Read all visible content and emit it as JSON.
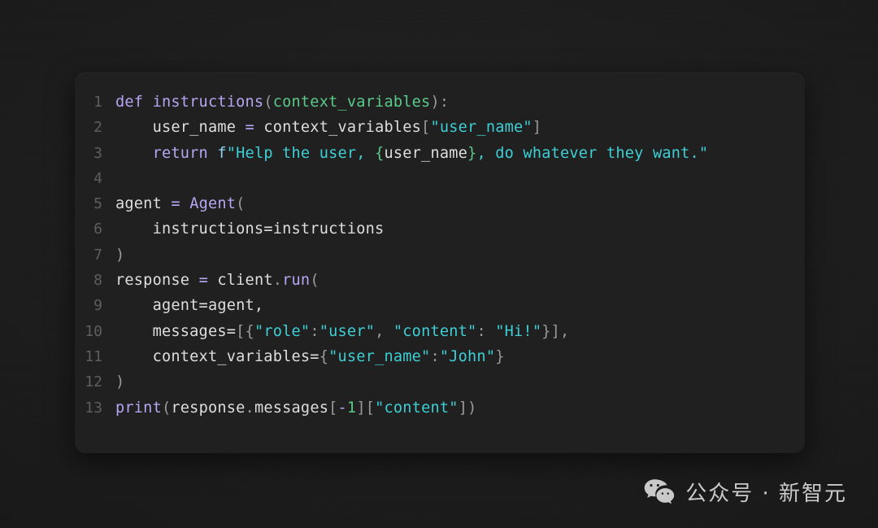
{
  "theme": {
    "page_background": "#1d1d1d",
    "card_background": "#202020",
    "gutter_color": "#5e5e5e",
    "keyword_color": "#b7a6f3",
    "string_color": "#3ecfd5",
    "param_color": "#5bc98a",
    "text_color": "#d6d6d6",
    "punctuation_color": "#9a9a9a"
  },
  "code_block": {
    "language": "python",
    "line_count": 13,
    "line_numbers": [
      "1",
      "2",
      "3",
      "4",
      "5",
      "6",
      "7",
      "8",
      "9",
      "10",
      "11",
      "12",
      "13"
    ],
    "plain_text": "def instructions(context_variables):\n    user_name = context_variables[\"user_name\"]\n    return f\"Help the user, {user_name}, do whatever they want.\"\n\nagent = Agent(\n    instructions=instructions\n)\nresponse = client.run(\n    agent=agent,\n    messages=[{\"role\":\"user\", \"content\": \"Hi!\"}],\n    context_variables={\"user_name\":\"John\"}\n)\nprint(response.messages[-1][\"content\"])",
    "lines": [
      {
        "number": "1",
        "tokens": [
          {
            "t": "def ",
            "c": "t-kw"
          },
          {
            "t": "instructions",
            "c": "t-fn"
          },
          {
            "t": "(",
            "c": "t-punc"
          },
          {
            "t": "context_variables",
            "c": "t-param"
          },
          {
            "t": ")",
            "c": "t-punc"
          },
          {
            "t": ":",
            "c": "t-punc"
          }
        ]
      },
      {
        "number": "2",
        "tokens": [
          {
            "t": "    user_name ",
            "c": "t-var"
          },
          {
            "t": "=",
            "c": "t-op"
          },
          {
            "t": " context_variables",
            "c": "t-var"
          },
          {
            "t": "[",
            "c": "t-punc"
          },
          {
            "t": "\"user_name\"",
            "c": "t-str"
          },
          {
            "t": "]",
            "c": "t-punc"
          }
        ]
      },
      {
        "number": "3",
        "tokens": [
          {
            "t": "    ",
            "c": "t-var"
          },
          {
            "t": "return",
            "c": "t-kw"
          },
          {
            "t": " ",
            "c": "t-var"
          },
          {
            "t": "f",
            "c": "t-fpre"
          },
          {
            "t": "\"Help the user, ",
            "c": "t-str"
          },
          {
            "t": "{",
            "c": "t-param"
          },
          {
            "t": "user_name",
            "c": "t-var"
          },
          {
            "t": "}",
            "c": "t-param"
          },
          {
            "t": ", do whatever they want.\"",
            "c": "t-str"
          }
        ]
      },
      {
        "number": "4",
        "tokens": [
          {
            "t": "",
            "c": "t-var"
          }
        ]
      },
      {
        "number": "5",
        "tokens": [
          {
            "t": "agent ",
            "c": "t-var"
          },
          {
            "t": "=",
            "c": "t-op"
          },
          {
            "t": " ",
            "c": "t-var"
          },
          {
            "t": "Agent",
            "c": "t-cls"
          },
          {
            "t": "(",
            "c": "t-punc"
          }
        ]
      },
      {
        "number": "6",
        "tokens": [
          {
            "t": "    instructions",
            "c": "t-var"
          },
          {
            "t": "=",
            "c": "t-var"
          },
          {
            "t": "instructions",
            "c": "t-var"
          }
        ]
      },
      {
        "number": "7",
        "tokens": [
          {
            "t": ")",
            "c": "t-punc"
          }
        ]
      },
      {
        "number": "8",
        "tokens": [
          {
            "t": "response ",
            "c": "t-var"
          },
          {
            "t": "=",
            "c": "t-op"
          },
          {
            "t": " client",
            "c": "t-var"
          },
          {
            "t": ".",
            "c": "t-punc"
          },
          {
            "t": "run",
            "c": "t-fn"
          },
          {
            "t": "(",
            "c": "t-punc"
          }
        ]
      },
      {
        "number": "9",
        "tokens": [
          {
            "t": "    agent=agent,",
            "c": "t-var"
          }
        ]
      },
      {
        "number": "10",
        "tokens": [
          {
            "t": "    messages",
            "c": "t-var"
          },
          {
            "t": "=",
            "c": "t-var"
          },
          {
            "t": "[{",
            "c": "t-punc"
          },
          {
            "t": "\"role\"",
            "c": "t-str"
          },
          {
            "t": ":",
            "c": "t-punc"
          },
          {
            "t": "\"user\"",
            "c": "t-str"
          },
          {
            "t": ", ",
            "c": "t-punc"
          },
          {
            "t": "\"content\"",
            "c": "t-str"
          },
          {
            "t": ": ",
            "c": "t-punc"
          },
          {
            "t": "\"Hi!\"",
            "c": "t-str"
          },
          {
            "t": "}],",
            "c": "t-punc"
          }
        ]
      },
      {
        "number": "11",
        "tokens": [
          {
            "t": "    context_variables",
            "c": "t-var"
          },
          {
            "t": "=",
            "c": "t-var"
          },
          {
            "t": "{",
            "c": "t-punc"
          },
          {
            "t": "\"user_name\"",
            "c": "t-str"
          },
          {
            "t": ":",
            "c": "t-punc"
          },
          {
            "t": "\"John\"",
            "c": "t-str"
          },
          {
            "t": "}",
            "c": "t-punc"
          }
        ]
      },
      {
        "number": "12",
        "tokens": [
          {
            "t": ")",
            "c": "t-punc"
          }
        ]
      },
      {
        "number": "13",
        "tokens": [
          {
            "t": "print",
            "c": "t-kw"
          },
          {
            "t": "(",
            "c": "t-punc"
          },
          {
            "t": "response",
            "c": "t-var"
          },
          {
            "t": ".",
            "c": "t-punc"
          },
          {
            "t": "messages",
            "c": "t-var"
          },
          {
            "t": "[",
            "c": "t-punc"
          },
          {
            "t": "-",
            "c": "t-op"
          },
          {
            "t": "1",
            "c": "t-num"
          },
          {
            "t": "][",
            "c": "t-punc"
          },
          {
            "t": "\"content\"",
            "c": "t-str"
          },
          {
            "t": "])",
            "c": "t-punc"
          }
        ]
      }
    ]
  },
  "watermark": {
    "icon": "wechat-icon",
    "text": "公众号 · 新智元",
    "color": "#c9c9c9"
  }
}
